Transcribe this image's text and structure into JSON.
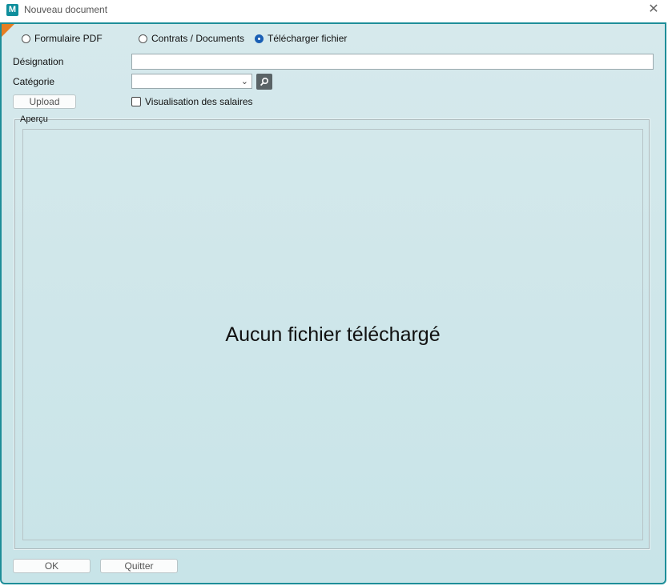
{
  "window": {
    "app_icon_letter": "M",
    "title": "Nouveau document",
    "close_glyph": "✕"
  },
  "doc_type": {
    "options": [
      {
        "label": "Formulaire PDF",
        "checked": false
      },
      {
        "label": "Contrats / Documents",
        "checked": false
      },
      {
        "label": "Télécharger fichier",
        "checked": true
      }
    ]
  },
  "form": {
    "designation_label": "Désignation",
    "designation_value": "",
    "categorie_label": "Catégorie",
    "categorie_value": "",
    "search_icon": "magnifier-icon",
    "upload_label": "Upload",
    "salary_checkbox_label": "Visualisation des salaires",
    "salary_checked": false
  },
  "preview": {
    "legend": "Aperçu",
    "message": "Aucun fichier téléchargé"
  },
  "footer": {
    "ok_label": "OK",
    "quit_label": "Quitter"
  },
  "colors": {
    "accent": "#1e8e99",
    "dialog_bg": "#cfe6ea",
    "corner": "#e67e22"
  }
}
